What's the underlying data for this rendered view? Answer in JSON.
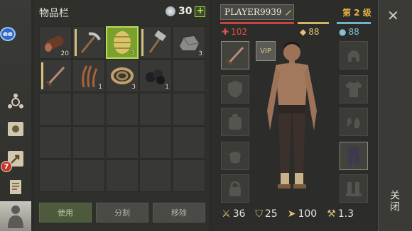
{
  "inventory": {
    "title": "物品栏",
    "coin_count": "30",
    "plus": "+",
    "slots": [
      {
        "name": "log",
        "qty": "20"
      },
      {
        "name": "pickaxe",
        "qty": "",
        "durability": true
      },
      {
        "name": "barrel",
        "qty": "3",
        "selected": true
      },
      {
        "name": "hammer",
        "qty": "",
        "durability": true
      },
      {
        "name": "stone",
        "qty": "3"
      },
      {
        "name": "sword",
        "qty": "",
        "durability": true
      },
      {
        "name": "plant-fiber",
        "qty": "1"
      },
      {
        "name": "rope",
        "qty": "3"
      },
      {
        "name": "coal",
        "qty": "1"
      }
    ],
    "actions": {
      "use": "使用",
      "split": "分割",
      "remove": "移除"
    }
  },
  "rail": {
    "ee_badge": "ee",
    "notification_count": "7"
  },
  "character": {
    "name": "PLAYER9939",
    "level": "第 2 级",
    "hp": "102",
    "food": "88",
    "water": "88",
    "vip": "VIP",
    "attack": "36",
    "defense": "25",
    "speed": "100",
    "weight": "1.3"
  },
  "close": {
    "x": "✕",
    "label": "关闭"
  },
  "colors": {
    "hp": "#c9433f",
    "food": "#d3b264",
    "water": "#73b3c9",
    "selected": "#7aa12c",
    "level": "#e8b342"
  }
}
